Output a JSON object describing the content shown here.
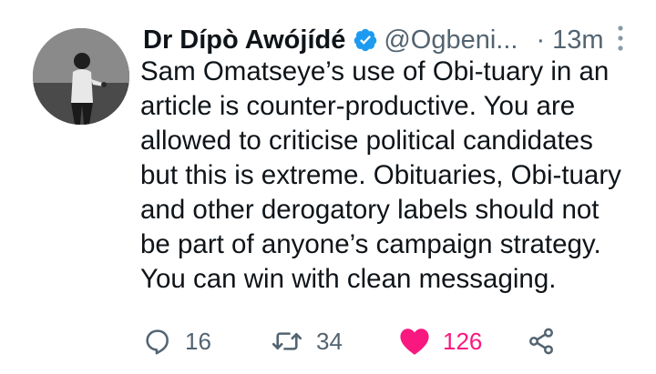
{
  "tweet": {
    "author_name": "Dr Dípò Awójídé",
    "handle": "@Ogbeni...",
    "separator": "·",
    "time": "13m",
    "lines": [
      "Sam Omatseye’s use of Obi-tuary in an",
      "article is counter-productive. You are",
      "allowed to criticise political candidates",
      "but this is extreme. Obituaries, Obi-tuary",
      "and other derogatory labels should not",
      "be part of anyone’s campaign strategy.",
      "You can win with clean messaging."
    ]
  },
  "actions": {
    "replies": "16",
    "retweets": "34",
    "likes": "126"
  },
  "icons": {
    "verified": "verified-badge-icon",
    "more": "more-vertical-icon",
    "reply": "reply-bubble-icon",
    "retweet": "retweet-icon",
    "like": "heart-filled-icon",
    "share": "share-icon"
  },
  "colors": {
    "verified": "#1d9bf0",
    "like": "#f91880",
    "muted": "#536471",
    "text": "#0f1419"
  }
}
